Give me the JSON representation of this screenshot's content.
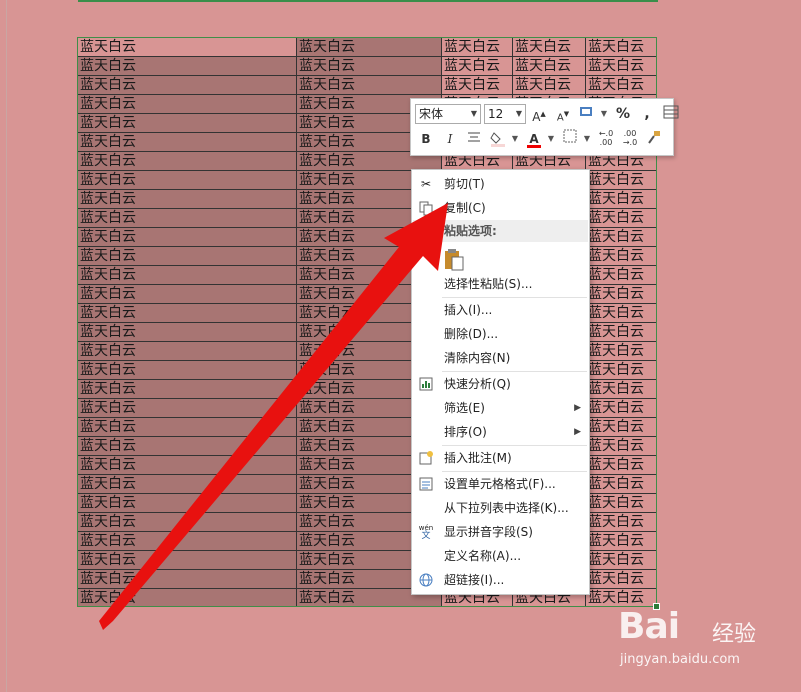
{
  "sheet": {
    "cell_text": "蓝天白云",
    "row_count": 30
  },
  "mini_toolbar": {
    "font_name": "宋体",
    "font_size": "12",
    "bold": "B",
    "italic": "I",
    "percent": "%",
    "comma": ","
  },
  "context_menu": {
    "items": [
      {
        "label": "剪切(T)",
        "icon": "scissors-icon"
      },
      {
        "label": "复制(C)",
        "icon": "copy-icon"
      },
      {
        "label": "粘贴选项:",
        "icon": ""
      },
      {
        "label": "选择性粘贴(S)...",
        "icon": ""
      },
      {
        "label": "插入(I)...",
        "icon": ""
      },
      {
        "label": "删除(D)...",
        "icon": ""
      },
      {
        "label": "清除内容(N)",
        "icon": ""
      },
      {
        "label": "快速分析(Q)",
        "icon": "quick-analysis-icon"
      },
      {
        "label": "筛选(E)",
        "icon": "",
        "submenu": true
      },
      {
        "label": "排序(O)",
        "icon": "",
        "submenu": true
      },
      {
        "label": "插入批注(M)",
        "icon": "comment-icon"
      },
      {
        "label": "设置单元格格式(F)...",
        "icon": "format-cells-icon"
      },
      {
        "label": "从下拉列表中选择(K)...",
        "icon": ""
      },
      {
        "label": "显示拼音字段(S)",
        "icon": "phonetic-icon"
      },
      {
        "label": "定义名称(A)...",
        "icon": ""
      },
      {
        "label": "超链接(I)...",
        "icon": "hyperlink-icon"
      }
    ]
  },
  "watermark": {
    "logo": "Bai",
    "text": "经验",
    "url": "jingyan.baidu.com"
  },
  "colors": {
    "background": "#d89594",
    "selected_cell": "#a87573",
    "arrow": "#e8110f"
  }
}
